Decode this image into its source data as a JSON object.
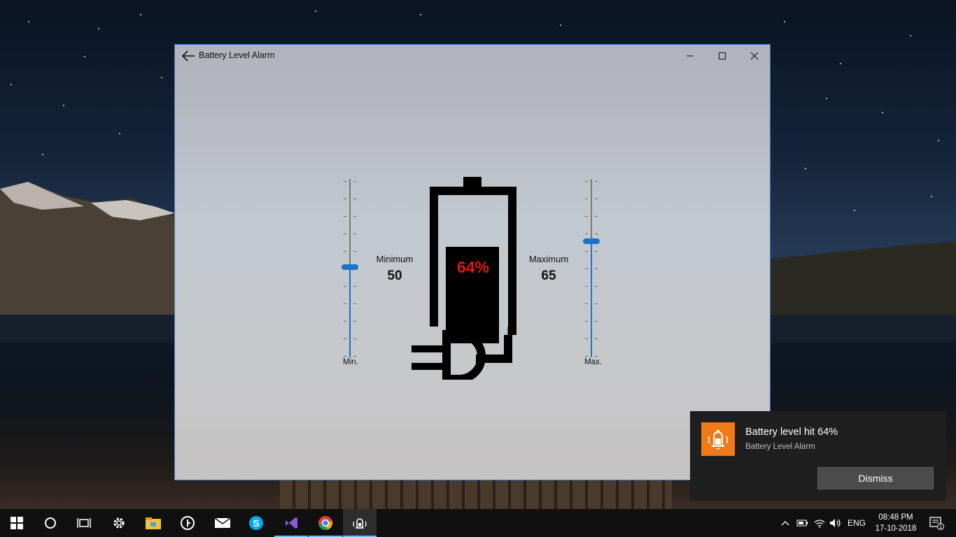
{
  "window": {
    "title": "Battery Level Alarm"
  },
  "app": {
    "min_slider_label": "Min.",
    "max_slider_label": "Max.",
    "minimum_caption": "Minimum",
    "minimum_value": "50",
    "maximum_caption": "Maximum",
    "maximum_value": "65",
    "battery_percent": "64%",
    "battery_level_fraction": 0.64,
    "accent_color": "#1a73c8",
    "percent_color": "#e11515"
  },
  "toast": {
    "title": "Battery level hit 64%",
    "app_name": "Battery Level Alarm",
    "dismiss_label": "Dismiss",
    "icon_color": "#f07a1a"
  },
  "taskbar": {
    "icons": [
      "windows-start-icon",
      "cortana-search-icon",
      "task-view-icon",
      "settings-gear-icon",
      "file-explorer-icon",
      "app-icon",
      "mail-icon",
      "skype-icon",
      "visual-studio-icon",
      "chrome-icon",
      "battery-alarm-app-icon"
    ],
    "language": "ENG",
    "time": "08:48 PM",
    "date": "17-10-2018",
    "notification_count": "1"
  }
}
